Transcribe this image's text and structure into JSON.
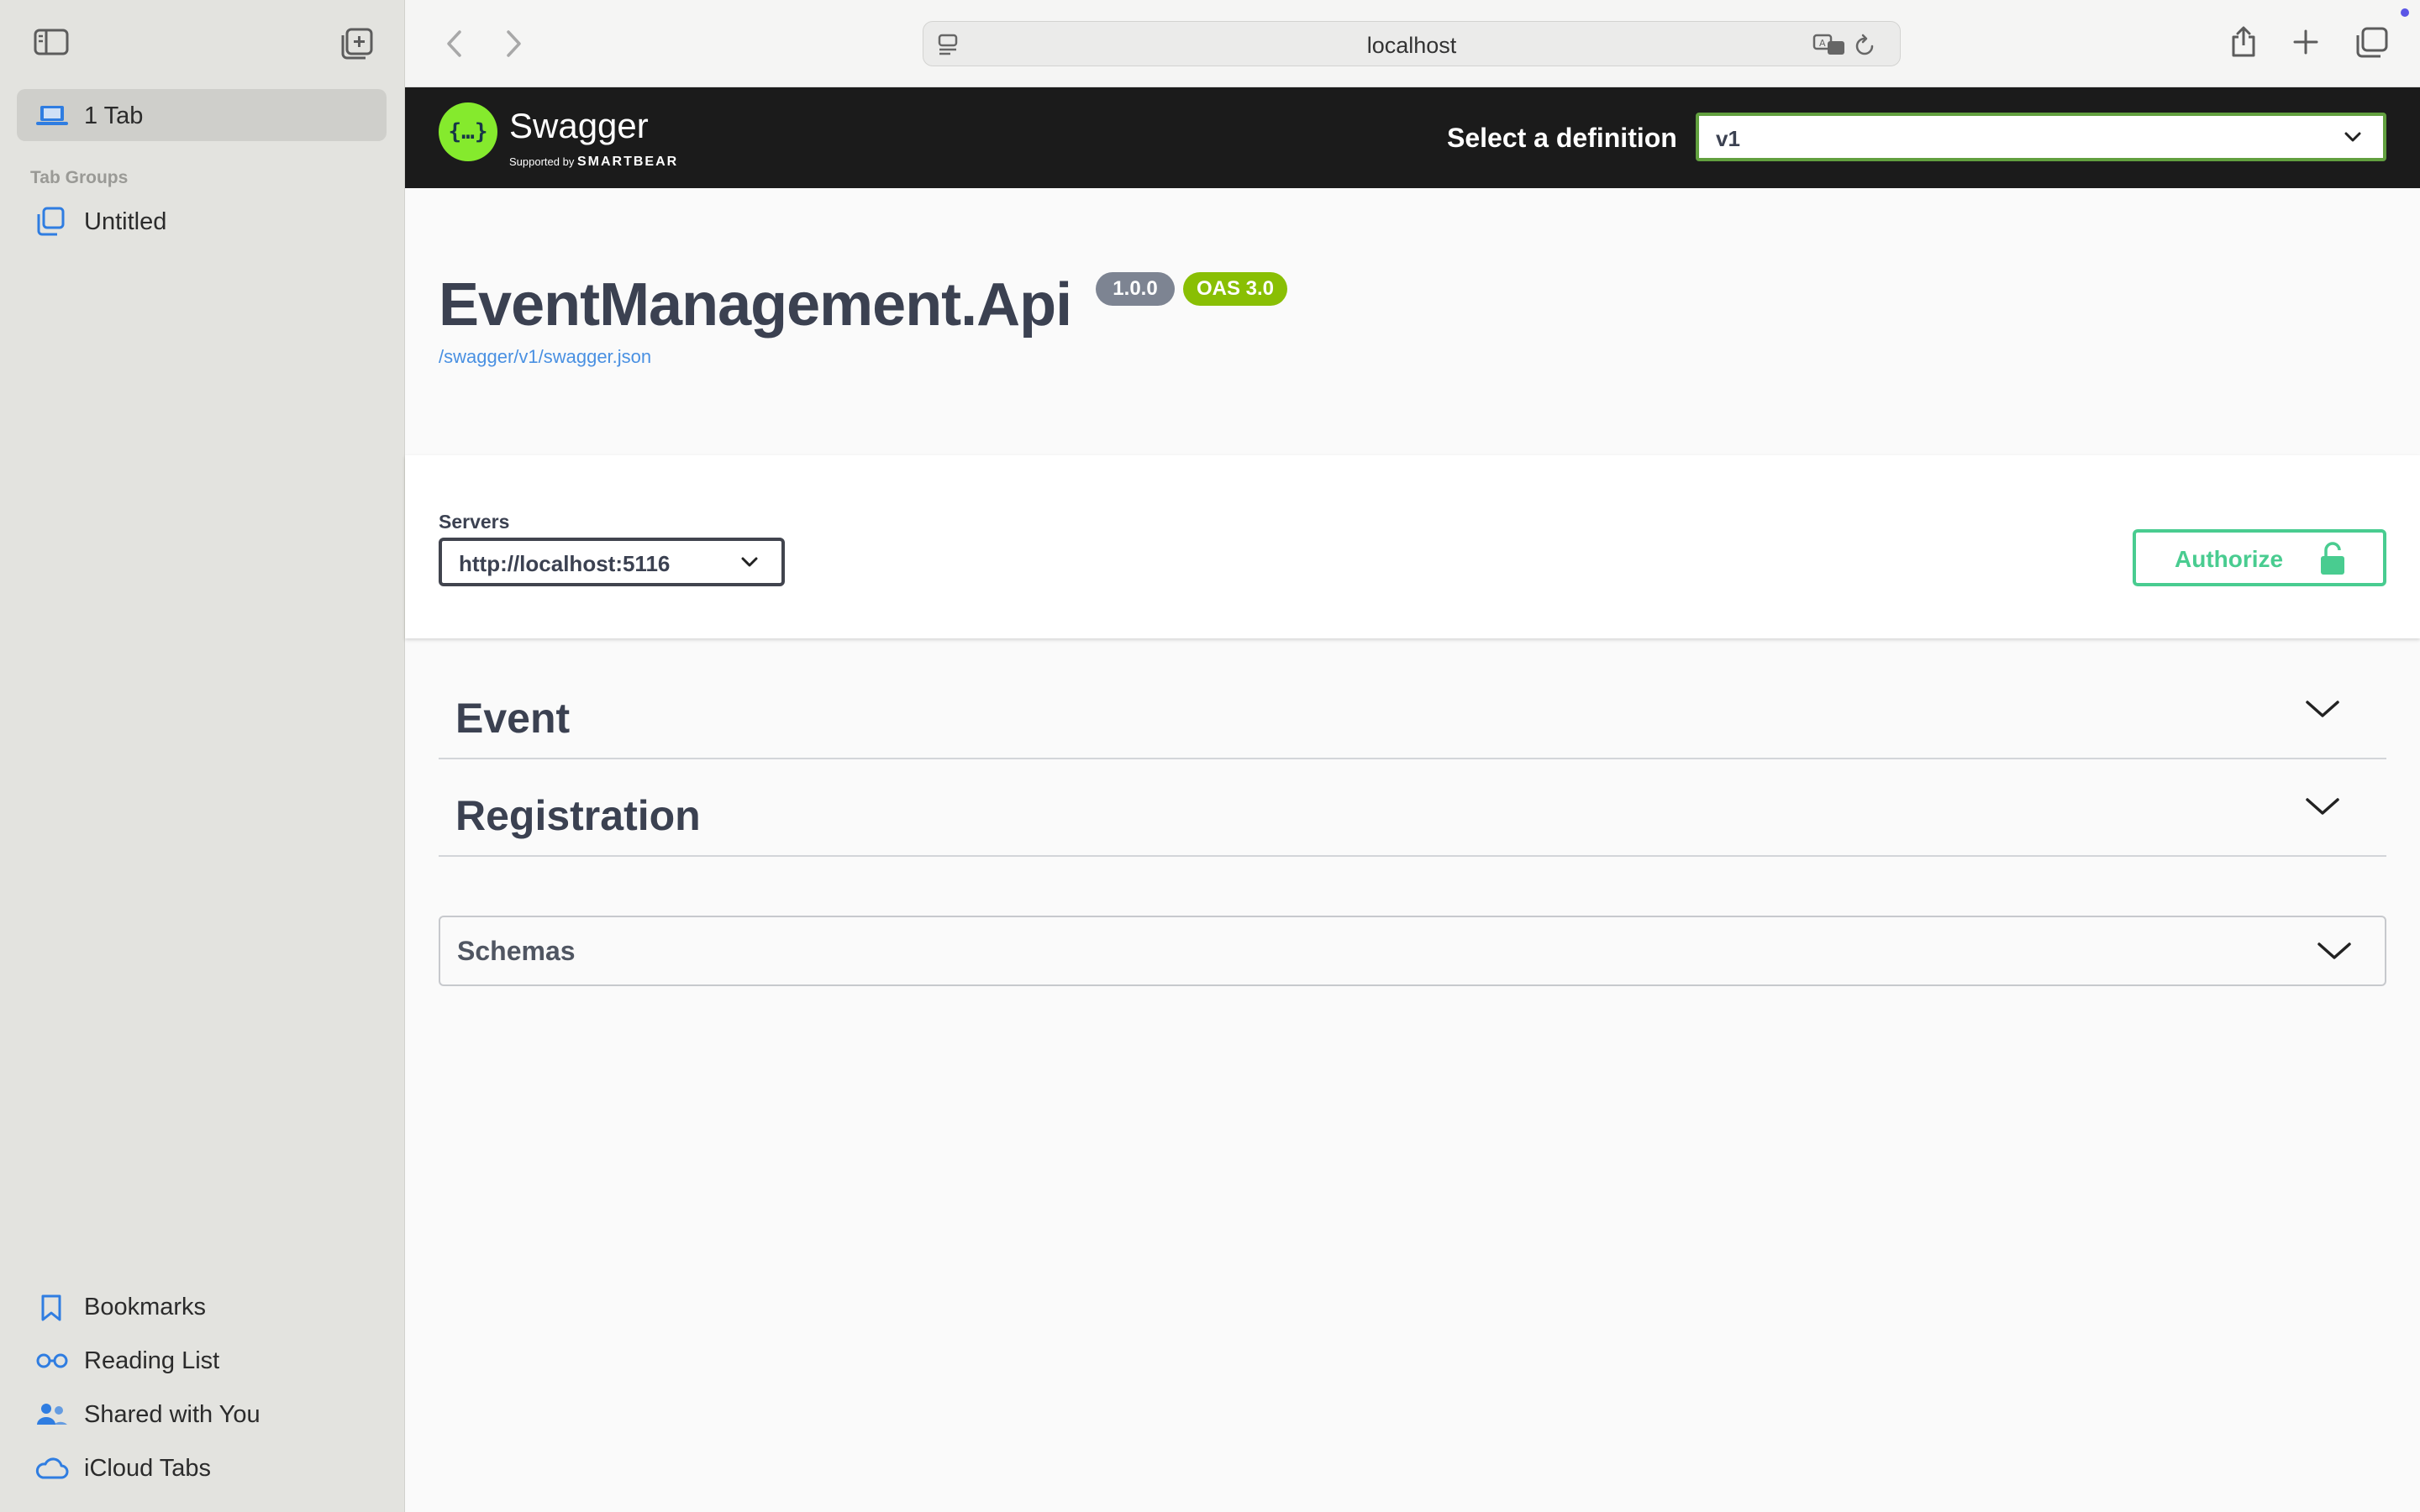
{
  "sidebar": {
    "current_tab_label": "1 Tab",
    "section_title": "Tab Groups",
    "tab_group_label": "Untitled",
    "bottom_items": [
      {
        "label": "Bookmarks",
        "icon": "bookmark-icon"
      },
      {
        "label": "Reading List",
        "icon": "reading-list-icon"
      },
      {
        "label": "Shared with You",
        "icon": "shared-with-you-icon"
      },
      {
        "label": "iCloud Tabs",
        "icon": "icloud-icon"
      }
    ]
  },
  "toolbar": {
    "url": "localhost"
  },
  "swagger": {
    "logo_name": "Swagger",
    "logo_supported_by": "Supported by",
    "logo_brand": "SMARTBEAR",
    "select_definition_label": "Select a definition",
    "definition_value": "v1",
    "api_title": "EventManagement.Api",
    "version_badge": "1.0.0",
    "oas_badge": "OAS 3.0",
    "spec_link": "/swagger/v1/swagger.json",
    "servers_label": "Servers",
    "server_value": "http://localhost:5116",
    "authorize_label": "Authorize",
    "tags": [
      {
        "name": "Event"
      },
      {
        "name": "Registration"
      }
    ],
    "schemas_label": "Schemas"
  },
  "colors": {
    "swagger_green": "#85ea2d",
    "authorize_green": "#49cc90",
    "link_blue": "#4990e2",
    "version_badge": "#7d8492",
    "oas_badge": "#89bf04",
    "sidebar_icon_blue": "#2f7de1"
  }
}
